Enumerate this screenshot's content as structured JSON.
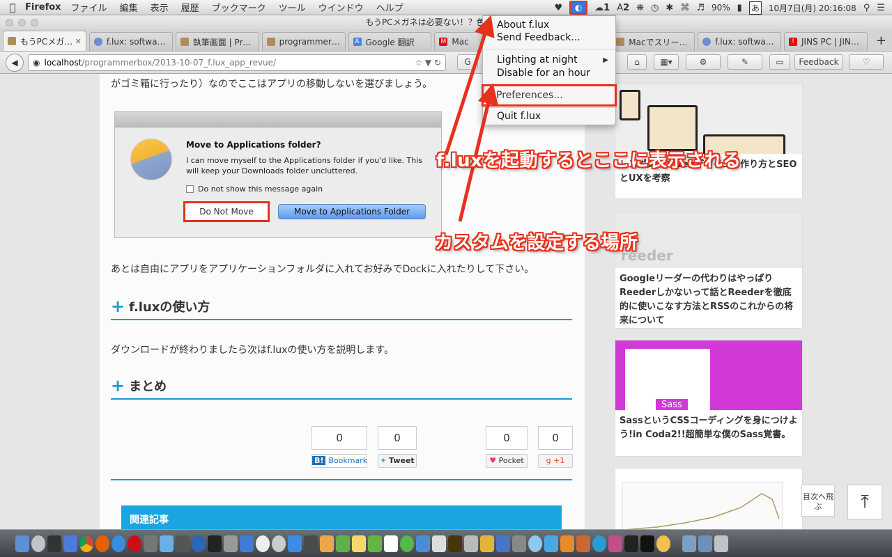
{
  "menubar": {
    "app_name": "Firefox",
    "menus": [
      "ファイル",
      "編集",
      "表示",
      "履歴",
      "ブックマーク",
      "ツール",
      "ウインドウ",
      "ヘルプ"
    ],
    "status": {
      "badge1": "1",
      "badge2": "2",
      "battery": "90%",
      "ime": "あ",
      "datetime": "10月7日(月)  20:16:08"
    }
  },
  "window": {
    "title": "もうPCメガネは必要ない！？色温度調整ア"
  },
  "tabs": [
    {
      "label": "もうPCメガ…",
      "active": true
    },
    {
      "label": "f.lux: softwa…"
    },
    {
      "label": "執筆画面 | Pr…"
    },
    {
      "label": "programmer…"
    },
    {
      "label": "Google 翻訳"
    },
    {
      "label": "Mac"
    },
    {
      "label": "Macでスリー…"
    },
    {
      "label": "f.lux: softwa…"
    },
    {
      "label": "JINS PC | JIN…"
    }
  ],
  "navbar": {
    "url_host": "localhost",
    "url_path": "/programmerbox/2013-10-07_f.lux_app_revue/",
    "feedback_label": "Feedback"
  },
  "flux_menu": {
    "items": [
      "About f.lux",
      "Send Feedback...",
      "Lighting at night",
      "Disable for an hour",
      "Preferences...",
      "Quit f.lux"
    ]
  },
  "article": {
    "para_top": "がゴミ箱に行ったり）なのでここはアプリの移動しないを選びましょう。",
    "dialog": {
      "title": "Move to Applications folder?",
      "text": "I can move myself to the Applications folder if you'd like. This will keep your Downloads folder uncluttered.",
      "checkbox": "Do not show this message again",
      "btn_no": "Do Not Move",
      "btn_yes": "Move to Applications Folder"
    },
    "para_after": "あとは自由にアプリをアプリケーションフォルダに入れてお好みでDockに入れたりして下さい。",
    "h_usage": "f.luxの使い方",
    "para_usage": "ダウンロードが終わりましたら次はf.luxの使い方を説明します。",
    "h_summary": "まとめ",
    "share": {
      "hatena": {
        "count": "0",
        "label": "Bookmark"
      },
      "tweet": {
        "count": "0",
        "label": "Tweet"
      },
      "pocket": {
        "count": "0",
        "label": "Pocket"
      },
      "gplus": {
        "count": "0",
        "label": "+1"
      }
    },
    "related": "関連記事"
  },
  "sidebar": [
    {
      "caption": "レスポンシブwebデザインの作り方とSEOとUXを考察"
    },
    {
      "caption": "Googleリーダーの代わりはやっぱりReederしかないって話とReederを徹底的に使いこなす方法とRSSのこれからの将来について",
      "img_label": "reeder"
    },
    {
      "caption": "SassというCSSコーディングを身につけよう!in Coda2!!超簡単な僕のSass覚書。",
      "img_label": "Sass"
    }
  ],
  "totop_label": "目次へ飛ぶ",
  "annotations": {
    "a1": "f.luxを起動するとここに表示される",
    "a2": "カスタムを設定する場所"
  },
  "colors": {
    "accent": "#1a9bd6",
    "annotation": "#e8301c"
  }
}
